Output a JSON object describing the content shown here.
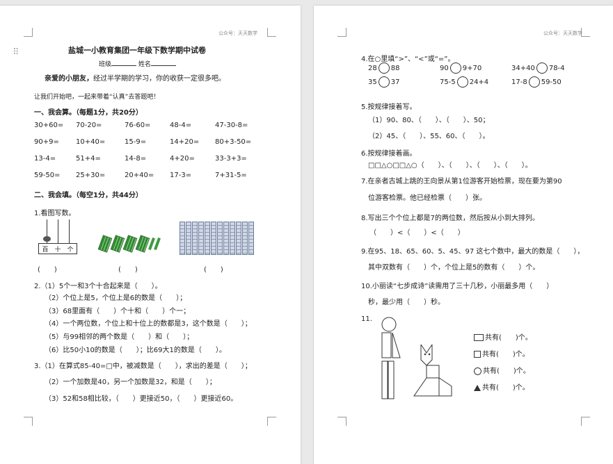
{
  "watermark": "公众号：天天数学",
  "p1": {
    "title": "盐城一小教育集团一年级下数学期中试卷",
    "class_label": "班级",
    "name_label": "姓名",
    "intro_bold": "亲爱的小朋友，",
    "intro_rest": "经过半学期的学习，你的收获一定很多吧。",
    "encourage": "让我们开始吧，一起来带着“认真”去答题吧！",
    "s1_title": "一、我会算。（每题1分，共20分）",
    "calc": [
      [
        "30+60=",
        "70-20=",
        "76-60=",
        "48-4=",
        "47-30-8="
      ],
      [
        "90+9=",
        "10+40=",
        "15-9=",
        "14+20=",
        "80+3-50="
      ],
      [
        "13-4=",
        "51+4=",
        "14-8=",
        "4+20=",
        "33-3+3="
      ],
      [
        "59-50=",
        "25+30=",
        "20+40=",
        "17-3=",
        "7+31-5="
      ]
    ],
    "s2_title": "二、我会填。（每空1分，共44分）",
    "q1": "1.看图写数。",
    "abacus_labels": [
      "百",
      "十",
      "个"
    ],
    "paren": [
      "(　　)",
      "(　　)",
      "(　　)"
    ],
    "q2": [
      "2.（1）5个一和3个十合起来是（　　）。",
      "（2）个位上是5，个位上是6的数是（　　）；",
      "（3）68里面有（　　）个十和（　　）个一；",
      "（4）一个两位数，个位上和十位上的数都是3，这个数是（　　）；",
      "（5）与99相邻的两个数是（　　）和（　　）；",
      "（6）比50小10的数是（　　）；比69大1的数是（　　）。"
    ],
    "q3": [
      "3.（1）在算式85-40=□中，被减数是（　　），求出的差是（　　）；",
      "（2）一个加数是40，另一个加数是32，和是（　　）；",
      "（3）52和58相比较，（　　）更接近50，（　　）更接近60。"
    ]
  },
  "p2": {
    "q4": "4.在○里填“>”、“<”或“=”。",
    "cmp": [
      [
        [
          "28",
          "88"
        ],
        [
          "90",
          "9+70"
        ],
        [
          "34+40",
          "78-4"
        ]
      ],
      [
        [
          "35",
          "37"
        ],
        [
          "75-5",
          "24+4"
        ],
        [
          "17-8",
          "59-50"
        ]
      ]
    ],
    "q5": "5.按规律接着写。",
    "q5_a": "（1）90、80、（　　）、（　　）、50；",
    "q5_b": "（2）45、（　　）、55、60、（　　）。",
    "q6": "6.按规律接着画。",
    "q6_seq": "□□△○□□△○（　　）、（　　）、（　　）、（　　）。",
    "q7_a": "7.在亲者古城上跳的王向景从第1位游客开始检票，现在要为第90",
    "q7_b": "位游客检票。他已经检票（　　）张。",
    "q8": "8.写出三个个位上都是7的两位数，然后按从小到大排列。",
    "q8_b": "（　　）<（　　）<（　　）",
    "q9_a": "9.在95、18、65、60、5、45、97 这七个数中，最大的数是（　　），",
    "q9_b": "其中双数有（　　）个，个位上是5的数有（　　）个。",
    "q10_a": "10.小丽读“七步成诗”读需用了三十几秒，小丽最多用（　　）",
    "q10_b": "秒，最少用（　　）秒。",
    "q11": "11.",
    "shapes": [
      {
        "icon": "rectangle",
        "text": "共有(　　)个。"
      },
      {
        "icon": "square",
        "text": "共有(　　)个。"
      },
      {
        "icon": "circle",
        "text": "共有(　　)个。"
      },
      {
        "icon": "triangle",
        "text": "共有(　　)个。"
      }
    ]
  }
}
